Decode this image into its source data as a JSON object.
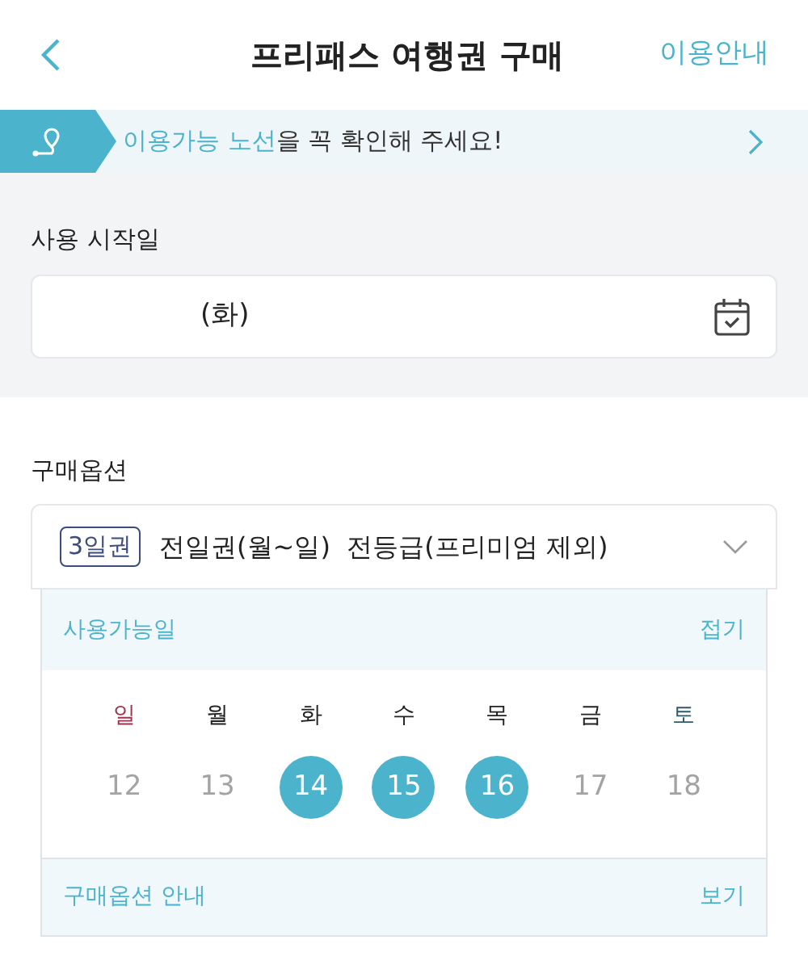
{
  "header": {
    "title": "프리패스 여행권 구매",
    "action": "이용안내"
  },
  "notice": {
    "highlight": "이용가능 노선",
    "text": "을 꼭 확인해 주세요!"
  },
  "start_date": {
    "label": "사용 시작일",
    "value": "(화)"
  },
  "purchase_option": {
    "label": "구매옵션",
    "badge": "3일권",
    "value": "전일권(월~일)  전등급(프리미엄 제외)",
    "expanded": true
  },
  "available_days": {
    "title": "사용가능일",
    "toggle": "접기",
    "weekdays": [
      {
        "label": "일",
        "color": "#a0334f"
      },
      {
        "label": "월",
        "color": "#222222"
      },
      {
        "label": "화",
        "color": "#222222"
      },
      {
        "label": "수",
        "color": "#222222"
      },
      {
        "label": "목",
        "color": "#222222"
      },
      {
        "label": "금",
        "color": "#222222"
      },
      {
        "label": "토",
        "color": "#2e5a6a"
      }
    ],
    "days": [
      {
        "label": "12",
        "selected": false
      },
      {
        "label": "13",
        "selected": false
      },
      {
        "label": "14",
        "selected": true
      },
      {
        "label": "15",
        "selected": true
      },
      {
        "label": "16",
        "selected": true
      },
      {
        "label": "17",
        "selected": false
      },
      {
        "label": "18",
        "selected": false
      }
    ]
  },
  "option_guide": {
    "title": "구매옵션 안내",
    "action": "보기"
  }
}
